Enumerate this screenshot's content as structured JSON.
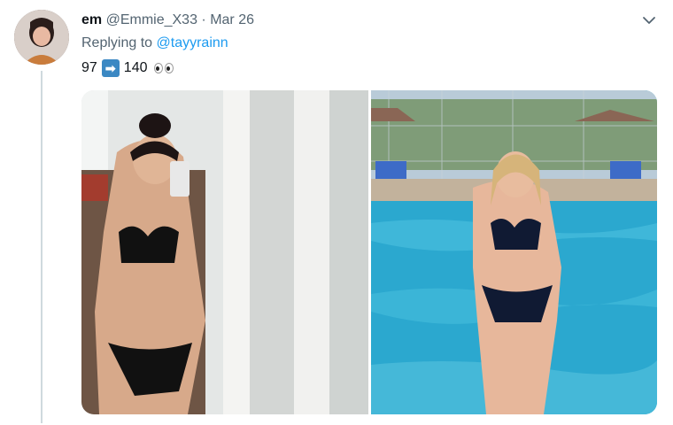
{
  "tweet": {
    "display_name": "em",
    "handle": "@Emmie_X33",
    "separator": "·",
    "date": "Mar 26",
    "replying_prefix": "Replying to",
    "replying_to": "@tayyrainn",
    "text_before": "97",
    "arrow_symbol": "➡",
    "text_after": "140",
    "emoji": "eyes"
  },
  "media": [
    {
      "description": "mirror selfie indoors"
    },
    {
      "description": "standing in swimming pool"
    }
  ],
  "colors": {
    "link": "#1d9bf0",
    "secondary_text": "#536471",
    "thread_line": "#cfd9de"
  }
}
